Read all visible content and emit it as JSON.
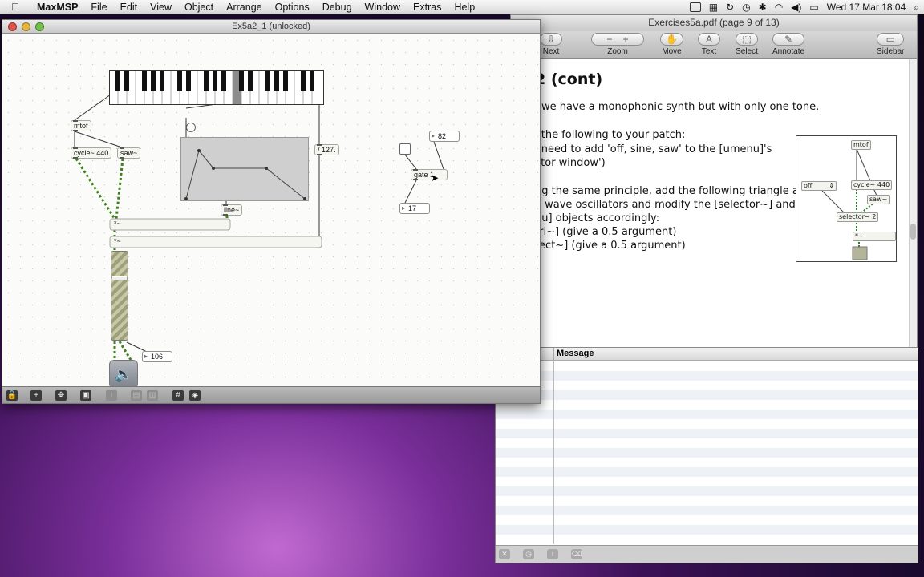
{
  "menubar": {
    "app_name": "MaxMSP",
    "items": [
      "File",
      "Edit",
      "View",
      "Object",
      "Arrange",
      "Options",
      "Debug",
      "Window",
      "Extras",
      "Help"
    ],
    "clock": "Wed 17 Mar  18:04"
  },
  "patcher": {
    "title": "Ex5a2_1 (unlocked)",
    "objects": {
      "mtof": "mtof",
      "cycle": "cycle~ 440",
      "saw": "saw~",
      "line": "line~",
      "div127": "/ 127.",
      "gate": "gate 1",
      "times1": "*~",
      "times2": "*~"
    },
    "numbers": {
      "n82": "82",
      "n17": "17",
      "n106": "106"
    },
    "gain_level": 0.7
  },
  "pdf": {
    "title": "Exercises5a.pdf (page 9 of 13)",
    "toolbar": [
      "Next",
      "Zoom",
      "Move",
      "Text",
      "Select",
      "Annotate",
      "Sidebar"
    ],
    "heading": "2 (cont)",
    "lines": [
      "we have a monophonic synth but with only one tone.",
      "l the following to your patch:",
      "l need to add 'off, sine, saw' to the [umenu]'s",
      "ctor window')",
      "ng the same principle, add the following triangle and",
      "e wave oscillators and modify the [selector~] and",
      "nu] objects accordingly:",
      "tri~] (give a 0.5 argument)",
      "rect~] (give a 0.5 argument)"
    ],
    "figure": {
      "mtof": "mtof",
      "off": "off",
      "cycle": "cycle~ 440",
      "saw": "saw~",
      "selector": "selector~ 2",
      "times": "*~"
    }
  },
  "console": {
    "column": "Message"
  }
}
